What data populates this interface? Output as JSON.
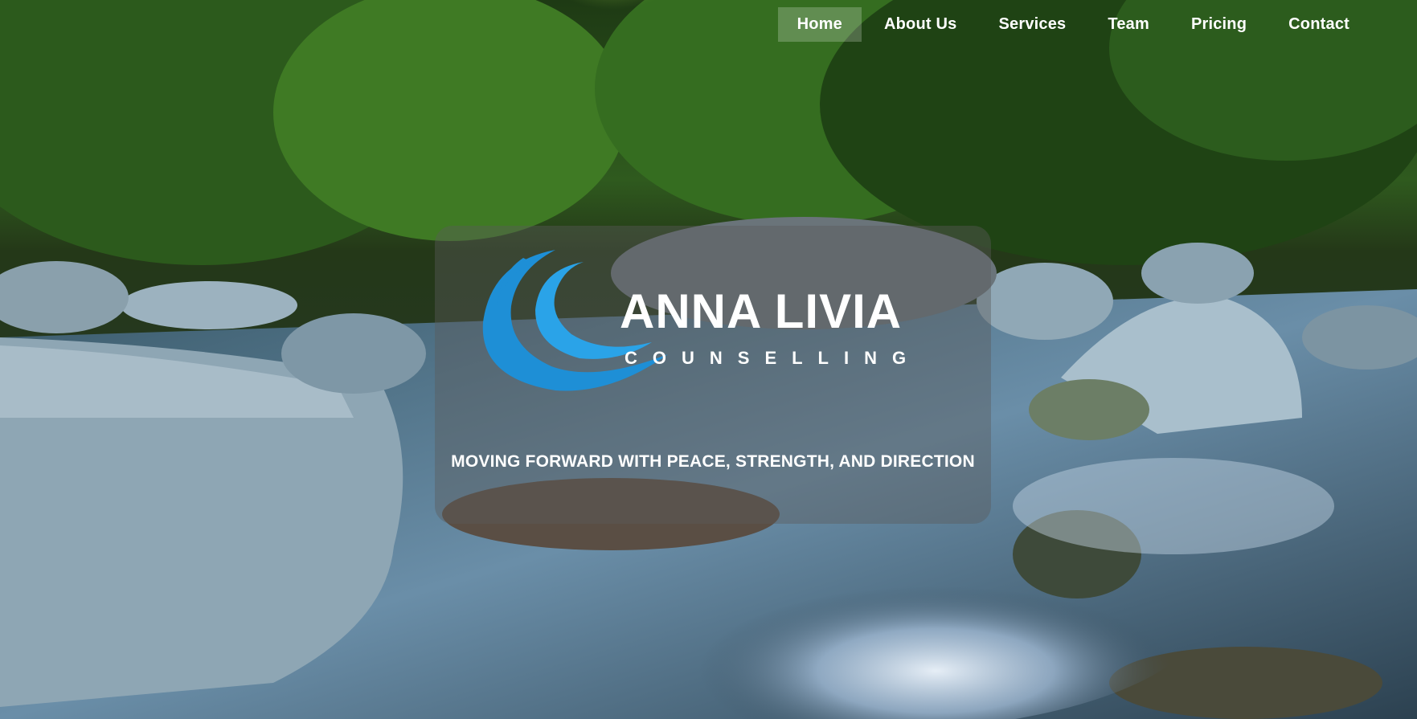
{
  "nav": {
    "items": [
      {
        "label": "Home",
        "active": true
      },
      {
        "label": "About Us",
        "active": false
      },
      {
        "label": "Services",
        "active": false
      },
      {
        "label": "Team",
        "active": false
      },
      {
        "label": "Pricing",
        "active": false
      },
      {
        "label": "Contact",
        "active": false
      }
    ]
  },
  "hero": {
    "logo_name": "ANNA LIVIA",
    "logo_sub": "COUNSELLING",
    "tagline": "MOVING FORWARD WITH PEACE, STRENGTH, AND DIRECTION"
  },
  "colors": {
    "logo_blue": "#1e8fd6",
    "overlay": "#5a5a5a"
  },
  "icons": [
    "wave-logo-icon"
  ]
}
